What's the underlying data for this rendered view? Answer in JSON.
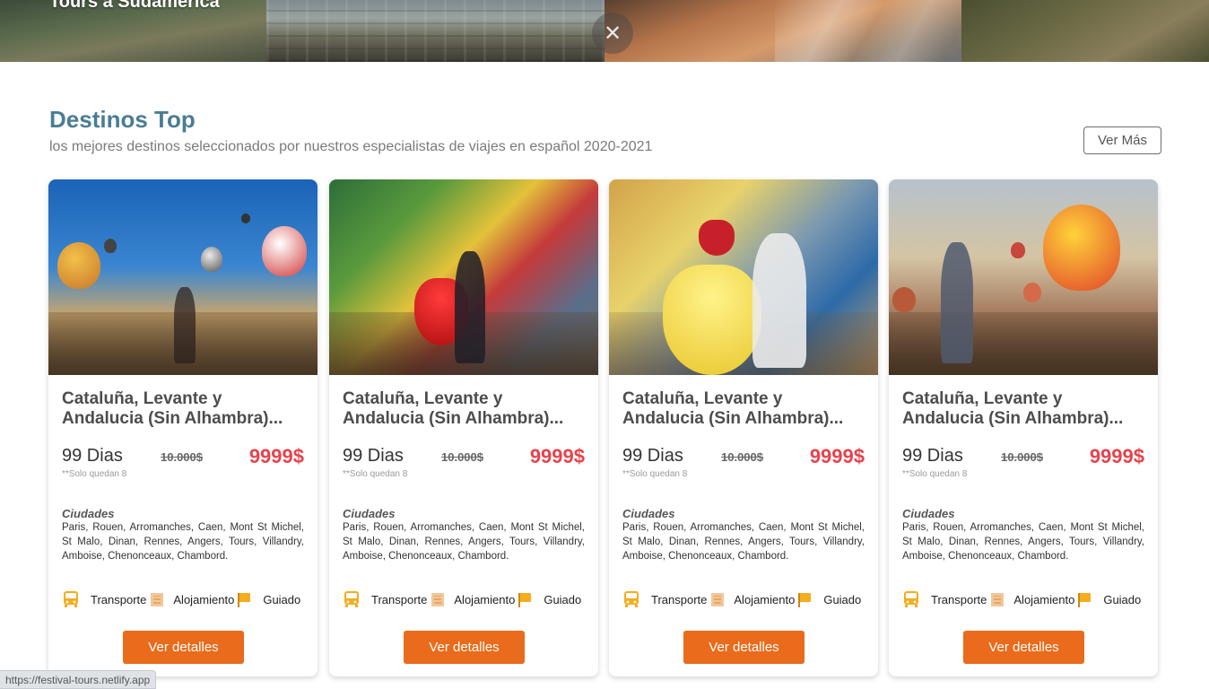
{
  "banner": {
    "title": "Tours a Sudamérica",
    "close_glyph": "✕"
  },
  "section": {
    "title": "Destinos Top",
    "subtitle": "los mejores destinos seleccionados por nuestros especialistas de viajes en español 2020-2021",
    "more_label": "Ver Más"
  },
  "cards": [
    {
      "title_line1": "Cataluña, Levante y",
      "title_line2": "Andalucia (Sin Alhambra)...",
      "duration": "99 Dias",
      "old_price": "10.000$",
      "price": "9999$",
      "remaining": "**Solo quedan 8",
      "cities_label": "Ciudades",
      "cities": "Paris, Rouen, Arromanches, Caen, Mont St Michel, St Malo, Dinan, Rennes, Angers, Tours, Villandry, Amboise, Chenonceaux, Chambord.",
      "feature_transport": "Transporte",
      "feature_lodging": "Alojamiento",
      "feature_guide": "Guiado",
      "button_label": "Ver detalles"
    },
    {
      "title_line1": "Cataluña, Levante y",
      "title_line2": "Andalucia (Sin Alhambra)...",
      "duration": "99 Dias",
      "old_price": "10.000$",
      "price": "9999$",
      "remaining": "**Solo quedan 8",
      "cities_label": "Ciudades",
      "cities": "Paris, Rouen, Arromanches, Caen, Mont St Michel, St Malo, Dinan, Rennes, Angers, Tours, Villandry, Amboise, Chenonceaux, Chambord.",
      "feature_transport": "Transporte",
      "feature_lodging": "Alojamiento",
      "feature_guide": "Guiado",
      "button_label": "Ver detalles"
    },
    {
      "title_line1": "Cataluña, Levante y",
      "title_line2": "Andalucia (Sin Alhambra)...",
      "duration": "99 Dias",
      "old_price": "10.000$",
      "price": "9999$",
      "remaining": "**Solo quedan 8",
      "cities_label": "Ciudades",
      "cities": "Paris, Rouen, Arromanches, Caen, Mont St Michel, St Malo, Dinan, Rennes, Angers, Tours, Villandry, Amboise, Chenonceaux, Chambord.",
      "feature_transport": "Transporte",
      "feature_lodging": "Alojamiento",
      "feature_guide": "Guiado",
      "button_label": "Ver detalles"
    },
    {
      "title_line1": "Cataluña, Levante y",
      "title_line2": "Andalucia (Sin Alhambra)...",
      "duration": "99 Dias",
      "old_price": "10.000$",
      "price": "9999$",
      "remaining": "**Solo quedan 8",
      "cities_label": "Ciudades",
      "cities": "Paris, Rouen, Arromanches, Caen, Mont St Michel, St Malo, Dinan, Rennes, Angers, Tours, Villandry, Amboise, Chenonceaux, Chambord.",
      "feature_transport": "Transporte",
      "feature_lodging": "Alojamiento",
      "feature_guide": "Guiado",
      "button_label": "Ver detalles"
    }
  ],
  "status_bar": {
    "url": "https://festival-tours.netlify.app"
  },
  "colors": {
    "accent_title": "#4a7d94",
    "price_red": "#e8424d",
    "button_orange": "#e96b1b",
    "icon_amber": "#f5ac1d"
  },
  "icons": [
    "close-icon",
    "bus-icon",
    "hotel-icon",
    "flag-icon"
  ]
}
